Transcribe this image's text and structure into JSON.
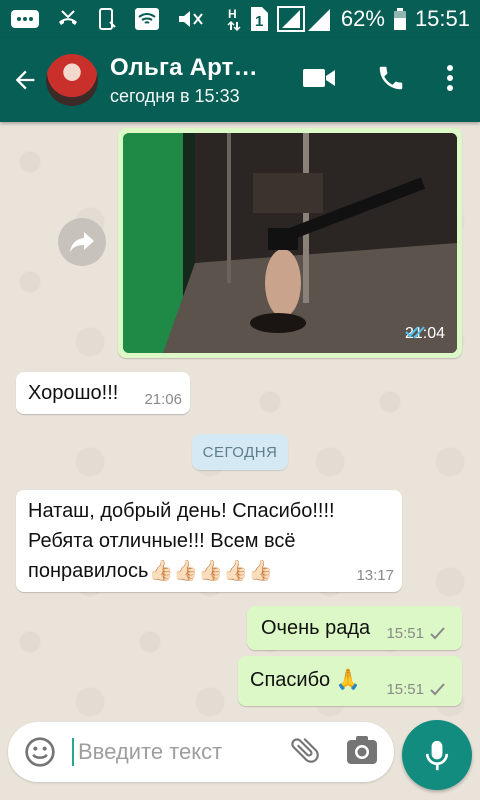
{
  "status": {
    "battery": "62%",
    "clock": "15:51",
    "sim_number": "1"
  },
  "header": {
    "contact_name": "Ольга Арт…",
    "last_seen": "сегодня в 15:33"
  },
  "messages": [
    {
      "type": "image",
      "direction": "out",
      "time": "21:04",
      "ticks": "read"
    },
    {
      "type": "text",
      "direction": "in",
      "text": "Хорошо!!!",
      "time": "21:06"
    },
    {
      "type": "date",
      "text": "СЕГОДНЯ"
    },
    {
      "type": "text",
      "direction": "in",
      "lines": [
        "Наташ, добрый день! Спасибо!!!!",
        "Ребята отличные!!! Всем всё",
        "понравилось👍🏻👍🏻👍🏻👍🏻👍🏻"
      ],
      "time": "13:17"
    },
    {
      "type": "text",
      "direction": "out",
      "text": "Очень рада",
      "time": "15:51",
      "ticks": "sent"
    },
    {
      "type": "text",
      "direction": "out",
      "text": "Спасибо 🙏",
      "time": "15:51",
      "ticks": "sent"
    }
  ],
  "composer": {
    "placeholder": "Введите текст"
  },
  "colors": {
    "primary": "#075e54",
    "accent": "#128c7e",
    "outgoing_bubble": "#dcf8c6",
    "incoming_bubble": "#ffffff",
    "read_ticks": "#4fc3f7"
  },
  "icons": [
    "whatsapp-icon",
    "missed-call-icon",
    "phone-icon",
    "wifi-icon",
    "mute-icon",
    "network-h-icon",
    "sim-icon",
    "signal-icon",
    "battery-icon",
    "back-arrow-icon",
    "video-call-icon",
    "voice-call-icon",
    "menu-dots-icon",
    "forward-icon",
    "double-check-icon",
    "single-check-icon",
    "emoji-icon",
    "attach-icon",
    "camera-icon",
    "mic-icon"
  ]
}
